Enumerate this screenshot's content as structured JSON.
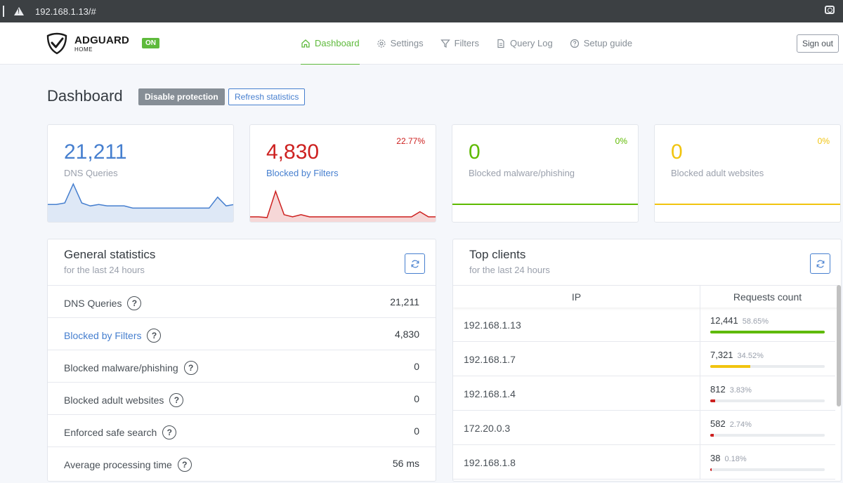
{
  "browser": {
    "url": "192.168.1.13/#"
  },
  "header": {
    "logo_title": "ADGUARD",
    "logo_sub": "HOME",
    "status_badge": "ON",
    "nav": [
      {
        "label": "Dashboard",
        "icon": "home-icon"
      },
      {
        "label": "Settings",
        "icon": "gear-icon"
      },
      {
        "label": "Filters",
        "icon": "filter-icon"
      },
      {
        "label": "Query Log",
        "icon": "document-icon"
      },
      {
        "label": "Setup guide",
        "icon": "help-circle-icon"
      }
    ],
    "sign_out": "Sign out"
  },
  "page": {
    "title": "Dashboard",
    "disable_protection": "Disable protection",
    "refresh_statistics": "Refresh statistics"
  },
  "stats": [
    {
      "value": "21,211",
      "label": "DNS Queries",
      "pct": "",
      "color": "#467fcf",
      "label_color": "#9aa0ac"
    },
    {
      "value": "4,830",
      "label": "Blocked by Filters",
      "pct": "22.77%",
      "color": "#cd201f",
      "label_color": "#467fcf"
    },
    {
      "value": "0",
      "label": "Blocked malware/phishing",
      "pct": "0%",
      "color": "#5eba00",
      "label_color": "#9aa0ac"
    },
    {
      "value": "0",
      "label": "Blocked adult websites",
      "pct": "0%",
      "color": "#f1c40f",
      "label_color": "#9aa0ac"
    }
  ],
  "sparklines": {
    "dns_queries": [
      20,
      20,
      22,
      48,
      22,
      18,
      20,
      18,
      18,
      18,
      15,
      15,
      15,
      15,
      15,
      15,
      15,
      15,
      15,
      15,
      30,
      18,
      20
    ],
    "blocked_filters": [
      3,
      3,
      2,
      38,
      6,
      3,
      6,
      3,
      3,
      3,
      3,
      3,
      3,
      3,
      3,
      3,
      3,
      3,
      3,
      3,
      10,
      3,
      3
    ]
  },
  "general_stats": {
    "title": "General statistics",
    "subtitle": "for the last 24 hours",
    "rows": [
      {
        "label": "DNS Queries",
        "value": "21,211"
      },
      {
        "label": "Blocked by Filters",
        "value": "4,830"
      },
      {
        "label": "Blocked malware/phishing",
        "value": "0"
      },
      {
        "label": "Blocked adult websites",
        "value": "0"
      },
      {
        "label": "Enforced safe search",
        "value": "0"
      },
      {
        "label": "Average processing time",
        "value": "56 ms"
      }
    ]
  },
  "top_clients": {
    "title": "Top clients",
    "subtitle": "for the last 24 hours",
    "col_ip": "IP",
    "col_requests": "Requests count",
    "rows": [
      {
        "ip": "192.168.1.13",
        "count": "12,441",
        "pct": "58.65%",
        "bar_pct": 100,
        "color": "#5eba00"
      },
      {
        "ip": "192.168.1.7",
        "count": "7,321",
        "pct": "34.52%",
        "bar_pct": 35,
        "color": "#f1c40f"
      },
      {
        "ip": "192.168.1.4",
        "count": "812",
        "pct": "3.83%",
        "bar_pct": 4,
        "color": "#cd201f"
      },
      {
        "ip": "172.20.0.3",
        "count": "582",
        "pct": "2.74%",
        "bar_pct": 3,
        "color": "#cd201f"
      },
      {
        "ip": "192.168.1.8",
        "count": "38",
        "pct": "0.18%",
        "bar_pct": 1,
        "color": "#cd201f"
      }
    ]
  }
}
